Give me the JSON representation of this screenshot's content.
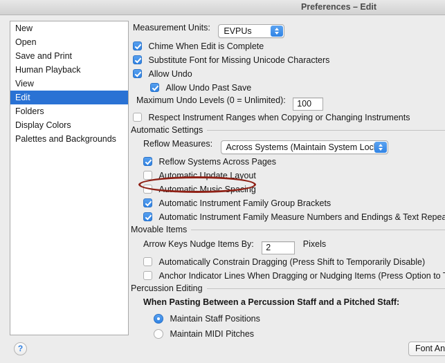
{
  "window": {
    "title": "Preferences – Edit"
  },
  "sidebar": {
    "items": [
      {
        "label": "New",
        "selected": false
      },
      {
        "label": "Open",
        "selected": false
      },
      {
        "label": "Save and Print",
        "selected": false
      },
      {
        "label": "Human Playback",
        "selected": false
      },
      {
        "label": "View",
        "selected": false
      },
      {
        "label": "Edit",
        "selected": true
      },
      {
        "label": "Folders",
        "selected": false
      },
      {
        "label": "Display Colors",
        "selected": false
      },
      {
        "label": "Palettes and Backgrounds",
        "selected": false
      }
    ],
    "selected_color": "#2a72d4"
  },
  "main": {
    "measurement_units": {
      "label": "Measurement Units:",
      "value": "EVPUs"
    },
    "chime_when_edit_complete": {
      "label": "Chime When Edit is Complete",
      "checked": true
    },
    "substitute_font": {
      "label": "Substitute Font for Missing Unicode Characters",
      "checked": true
    },
    "allow_undo": {
      "label": "Allow Undo",
      "checked": true
    },
    "allow_undo_past_save": {
      "label": "Allow Undo Past Save",
      "checked": true
    },
    "maximum_undo_levels": {
      "label": "Maximum Undo Levels (0 = Unlimited):",
      "value": "100"
    },
    "respect_instrument_ranges": {
      "label": "Respect Instrument Ranges when Copying or Changing Instruments",
      "checked": false
    },
    "automatic_settings": {
      "section_title": "Automatic Settings",
      "reflow_measures": {
        "label": "Reflow Measures:",
        "value": "Across Systems (Maintain System Locks)"
      },
      "reflow_systems_across_pages": {
        "label": "Reflow Systems Across Pages",
        "checked": true
      },
      "automatic_update_layout": {
        "label": "Automatic Update Layout",
        "checked": false
      },
      "automatic_music_spacing": {
        "label": "Automatic Music Spacing",
        "checked": false
      },
      "automatic_family_group_brackets": {
        "label": "Automatic Instrument Family Group Brackets",
        "checked": true
      },
      "automatic_family_measure_numbers": {
        "label": "Automatic Instrument Family Measure Numbers and Endings & Text Repeats",
        "checked": true
      }
    },
    "movable_items": {
      "section_title": "Movable Items",
      "nudge": {
        "label": "Arrow Keys Nudge Items By:",
        "value": "2",
        "unit": "Pixels"
      },
      "constrain_dragging": {
        "label": "Automatically Constrain Dragging (Press Shift to Temporarily Disable)",
        "checked": false
      },
      "anchor_indicator_lines": {
        "label": "Anchor Indicator Lines When Dragging or Nudging Items (Press Option to Temp",
        "checked": false
      }
    },
    "percussion_editing": {
      "section_title": "Percussion Editing",
      "prompt": "When Pasting Between a Percussion Staff and a Pitched Staff:",
      "options": [
        {
          "label": "Maintain Staff Positions",
          "selected": true
        },
        {
          "label": "Maintain MIDI Pitches",
          "selected": false
        }
      ]
    }
  },
  "footer": {
    "help_glyph": "?",
    "font_button_label": "Font An"
  },
  "annotation": {
    "target": "Automatic Music Spacing",
    "shape": "ellipse",
    "color": "#8f2116"
  }
}
